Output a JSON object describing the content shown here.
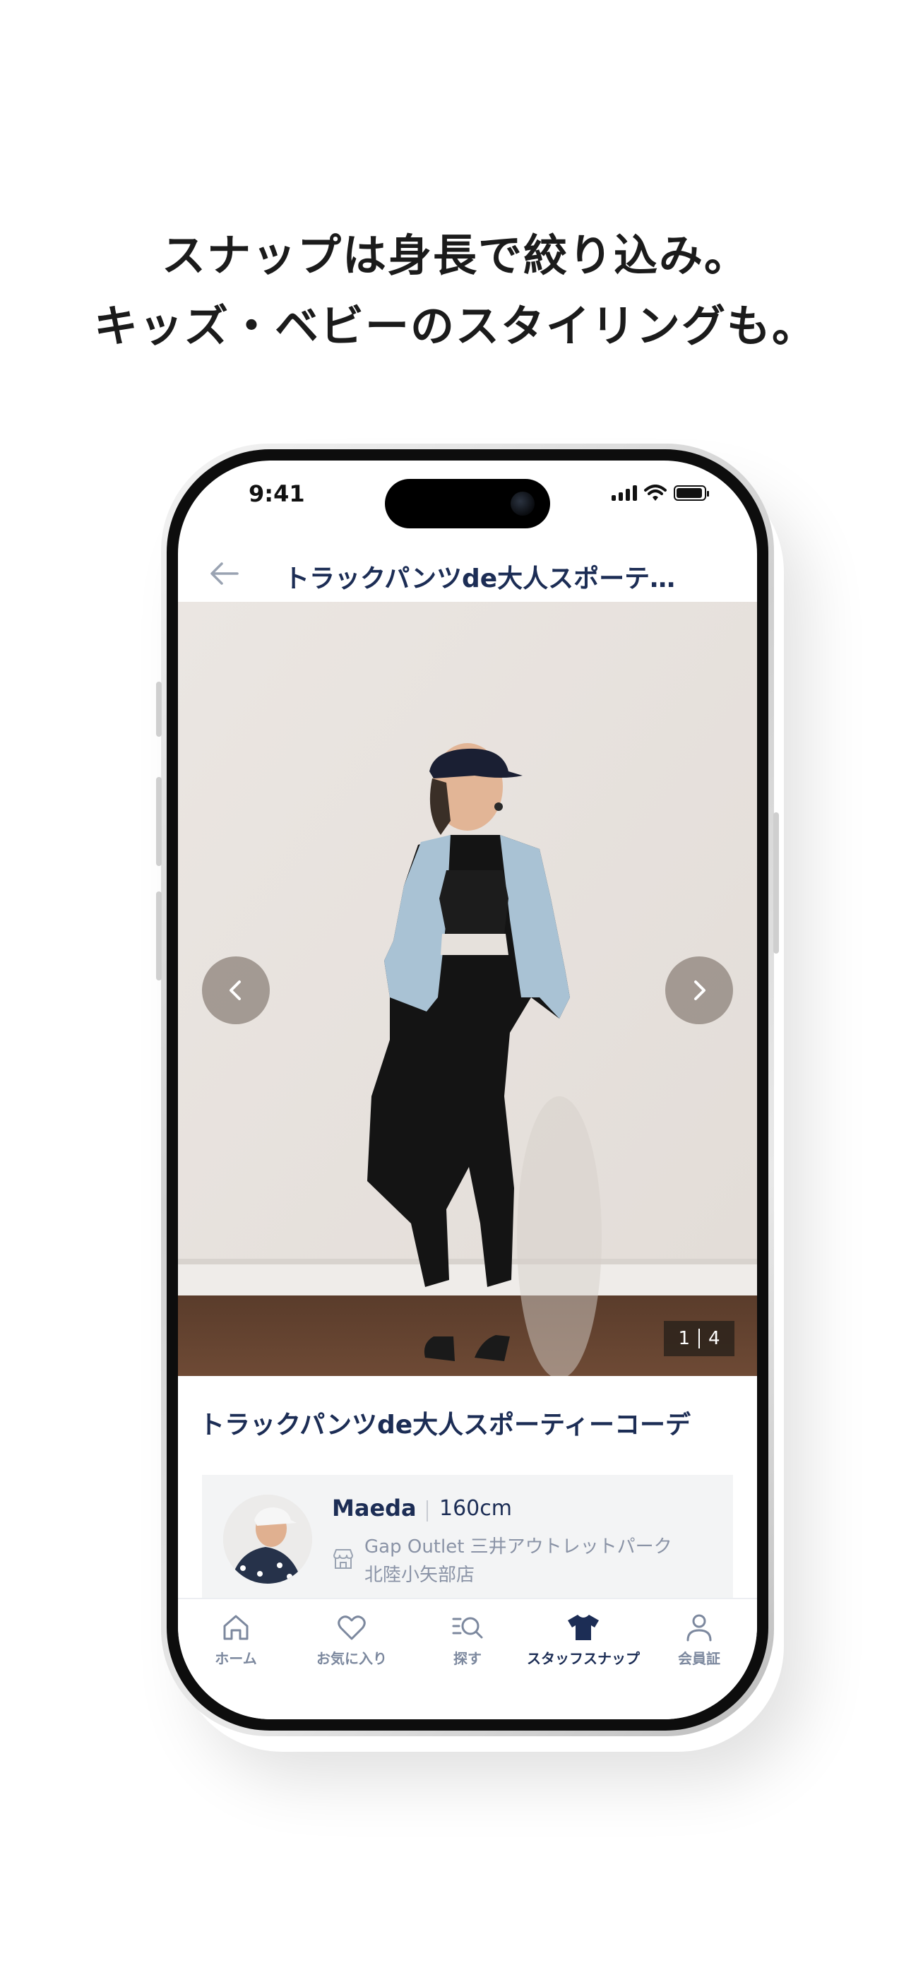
{
  "headline": {
    "line1": "スナップは身長で絞り込み。",
    "line2": "キッズ・ベビーのスタイリングも。"
  },
  "status_bar": {
    "time": "9:41",
    "icons": [
      "signal-icon",
      "wifi-icon",
      "battery-icon"
    ]
  },
  "top_bar": {
    "back_icon": "arrow-left-icon",
    "title": "トラックパンツde大人スポーテ…"
  },
  "photo": {
    "counter_current": "1",
    "counter_total": "4",
    "prev_icon": "chevron-left-icon",
    "next_icon": "chevron-right-icon"
  },
  "snap": {
    "title": "トラックパンツde大人スポーティーコーデ"
  },
  "staff": {
    "name": "Maeda",
    "height": "160cm",
    "store_icon": "store-icon",
    "store_line1": "Gap Outlet 三井アウトレットパーク",
    "store_line2": "北陸小矢部店"
  },
  "tabbar": {
    "active_index": 3,
    "accent_color": "#1c2d55",
    "inactive_color": "#7c889e",
    "items": [
      {
        "label": "ホーム",
        "icon": "home-icon"
      },
      {
        "label": "お気に入り",
        "icon": "heart-icon"
      },
      {
        "label": "探す",
        "icon": "search-list-icon"
      },
      {
        "label": "スタッフスナップ",
        "icon": "tshirt-icon"
      },
      {
        "label": "会員証",
        "icon": "user-icon"
      }
    ]
  }
}
